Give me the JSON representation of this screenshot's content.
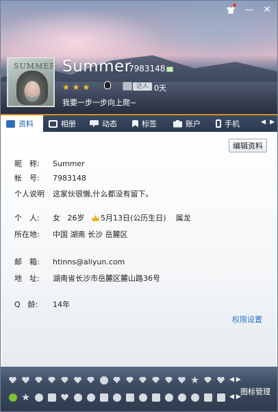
{
  "header": {
    "nickname": "Summer",
    "uid": "7983148",
    "avatar_text": "SUMMER",
    "badge_label": "达人",
    "days": "0天",
    "signature": "我要一步一步向上爬~",
    "stars": 3
  },
  "titlebar": {
    "buttons": [
      "shirt-icon",
      "minimize",
      "close"
    ],
    "minimize_glyph": "—",
    "close_glyph": "✕"
  },
  "tabs": [
    {
      "label": "资料",
      "icon": "profile-card-icon",
      "active": true
    },
    {
      "label": "相册",
      "icon": "album-icon"
    },
    {
      "label": "动态",
      "icon": "feed-icon"
    },
    {
      "label": "标签",
      "icon": "tag-icon"
    },
    {
      "label": "账户",
      "icon": "account-icon"
    },
    {
      "label": "手机",
      "icon": "phone-icon"
    }
  ],
  "tab_arrows": {
    "left": "◀",
    "right": "▶"
  },
  "profile": {
    "edit_button": "编辑资料",
    "nickname_key": "昵　称:",
    "nickname_val": "Summer",
    "account_key": "帐　号:",
    "account_val": "7983148",
    "desc_key": "个人说明",
    "desc_val": "这家伙很懒,什么都没有留下。",
    "person_key": "个　人:",
    "gender": "女",
    "age": "26岁",
    "birthday": "5月13日(公历生日)",
    "zodiac": "属龙",
    "location_key": "所在地:",
    "location_val": "中国 湖南 长沙 岳麓区",
    "email_key": "邮　箱:",
    "email_val": "htinns@aliyun.com",
    "address_key": "地　址:",
    "address_val": "湖南省长沙市岳麓区麓山路36号",
    "qage_key": "Q　龄:",
    "qage_val": "14年",
    "permission_link": "权限设置"
  },
  "bottom": {
    "manage_label": "图标管理",
    "arrows_left": "◀",
    "arrows_right": "▶"
  }
}
